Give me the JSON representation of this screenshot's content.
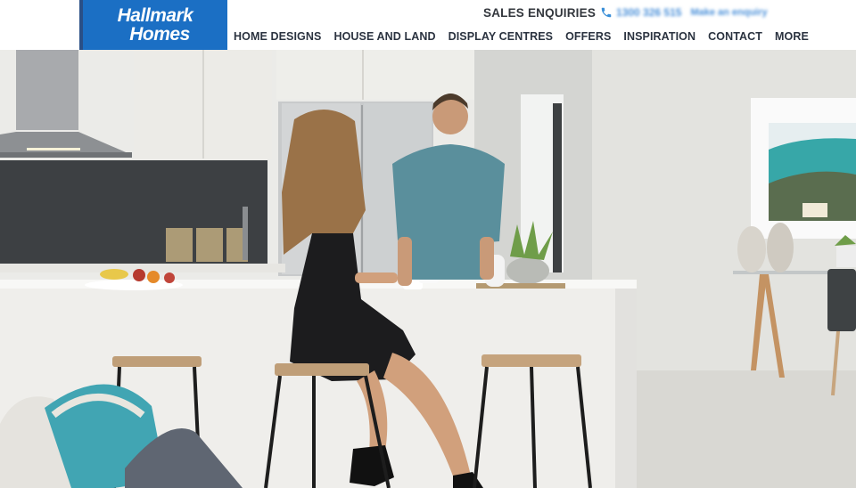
{
  "brand": {
    "logo_line1": "Hallmark",
    "logo_line2": "Homes",
    "color": "#1b6fc4"
  },
  "header": {
    "enquiries_label": "SALES ENQUIRIES",
    "phone_icon": "phone-icon",
    "phone_number": "1300 326 515",
    "enquiry_link": "Make an enquiry"
  },
  "nav": {
    "items": [
      {
        "label": "HOME DESIGNS"
      },
      {
        "label": "HOUSE AND LAND"
      },
      {
        "label": "DISPLAY CENTRES"
      },
      {
        "label": "OFFERS"
      },
      {
        "label": "INSPIRATION"
      },
      {
        "label": "CONTACT"
      },
      {
        "label": "MORE"
      }
    ]
  },
  "hero": {
    "scene": "kitchen-interior-photo"
  },
  "colors": {
    "accent": "#1b6fc4",
    "nav_text": "#2b3340",
    "link": "#4a90d9"
  }
}
